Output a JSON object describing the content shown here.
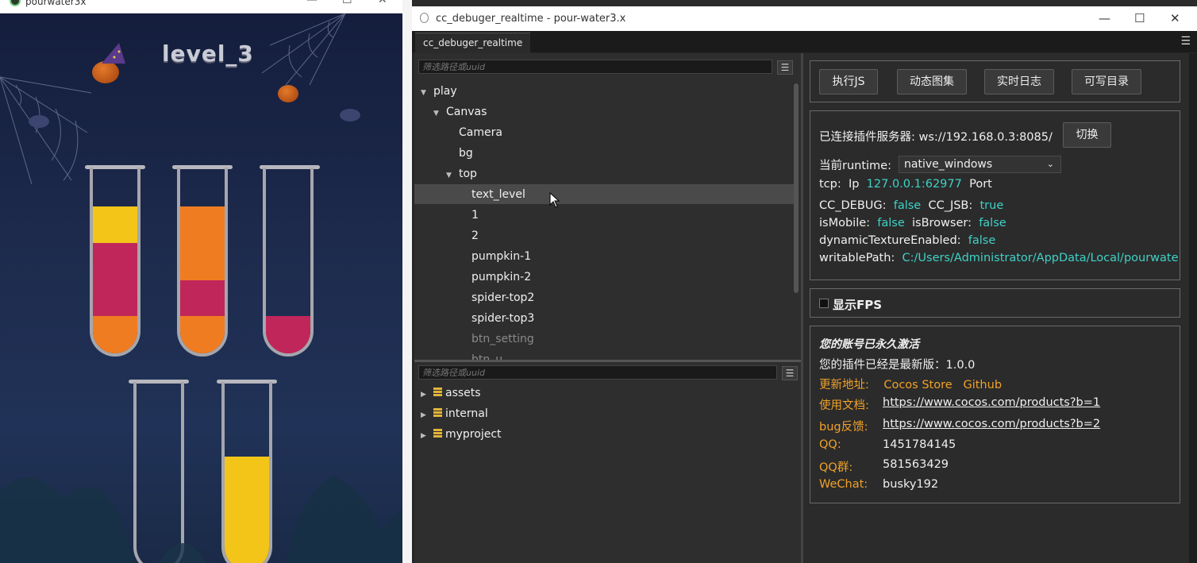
{
  "game_window": {
    "title": "pourwater3x",
    "level_label": "level_3",
    "tubes": [
      {
        "segments": [
          "#f2c518",
          "#c1265a",
          "#c1265a",
          "#f07c22"
        ]
      },
      {
        "segments": [
          "#f07c22",
          "#f07c22",
          "#c1265a",
          "#f07c22"
        ]
      },
      {
        "segments": [
          "#c1265a"
        ]
      },
      {
        "segments": []
      },
      {
        "segments": [
          "#f2c518",
          "#f2c518",
          "#f2c518"
        ]
      }
    ]
  },
  "debugger_window": {
    "title": "cc_debuger_realtime - pour-water3.x",
    "tab_label": "cc_debuger_realtime",
    "node_tree": {
      "filter_placeholder": "筛选路径或uuid",
      "nodes": [
        {
          "label": "play",
          "expanded": true
        },
        {
          "label": "Canvas",
          "expanded": true
        },
        {
          "label": "Camera"
        },
        {
          "label": "bg"
        },
        {
          "label": "top",
          "expanded": true
        },
        {
          "label": "text_level",
          "selected": true
        },
        {
          "label": "1"
        },
        {
          "label": "2"
        },
        {
          "label": "pumpkin-1"
        },
        {
          "label": "pumpkin-2"
        },
        {
          "label": "spider-top2"
        },
        {
          "label": "spider-top3"
        },
        {
          "label": "btn_setting",
          "inactive": true
        },
        {
          "label": "btn_u",
          "inactive": true
        }
      ]
    },
    "asset_tree": {
      "filter_placeholder": "筛选路径或uuid",
      "items": [
        {
          "label": "assets"
        },
        {
          "label": "internal"
        },
        {
          "label": "myproject"
        }
      ]
    },
    "toolbar": {
      "buttons": [
        "执行JS",
        "动态图集",
        "实时日志",
        "可写目录"
      ]
    },
    "connection": {
      "server_label": "已连接插件服务器:",
      "server_value": "ws://192.168.0.3:8085/",
      "switch_button": "切换",
      "runtime_label": "当前runtime:",
      "runtime_value": "native_windows",
      "tcp_label": "tcp:",
      "ip_label": "Ip",
      "ip_value": "127.0.0.1:62977",
      "port_label": "Port",
      "cc_debug_label": "CC_DEBUG:",
      "cc_debug_value": "false",
      "cc_jsb_label": "CC_JSB:",
      "cc_jsb_value": "true",
      "is_mobile_label": "isMobile:",
      "is_mobile_value": "false",
      "is_browser_label": "isBrowser:",
      "is_browser_value": "false",
      "dynamic_texture_label": "dynamicTextureEnabled:",
      "dynamic_texture_value": "false",
      "writable_path_label": "writablePath:",
      "writable_path_value": "C:/Users/Administrator/AppData/Local/pourwate"
    },
    "fps": {
      "label": "显示FPS",
      "checked": false
    },
    "account": {
      "activated_text": "您的账号已永久激活",
      "version_text": "您的插件已经是最新版：1.0.0",
      "update_label": "更新地址:",
      "store_link": "Cocos Store",
      "github_link": "Github",
      "docs_label": "使用文档:",
      "docs_url": "https://www.cocos.com/products?b=1",
      "bug_label": "bug反馈:",
      "bug_url": "https://www.cocos.com/products?b=2",
      "qq_label": "QQ:",
      "qq_value": "1451784145",
      "qq_group_label": "QQ群:",
      "qq_group_value": "581563429",
      "wechat_label": "WeChat:",
      "wechat_value": "busky192"
    }
  }
}
